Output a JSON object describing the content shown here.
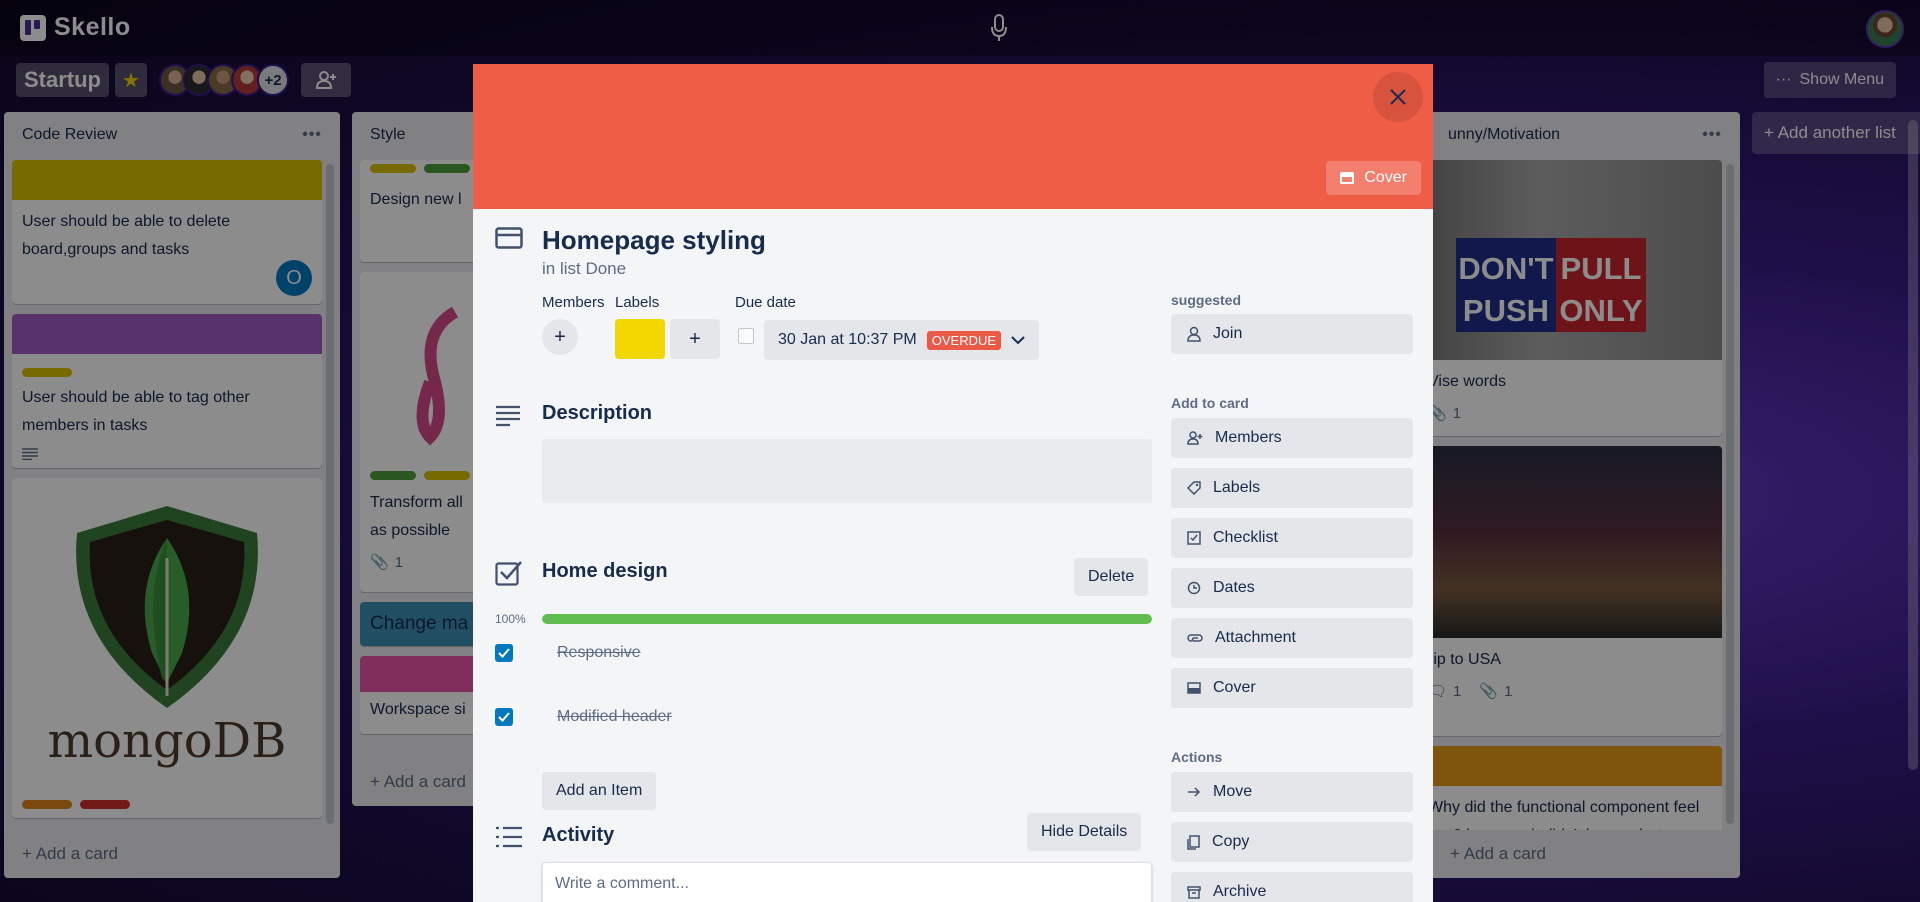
{
  "app": {
    "name": "Skello"
  },
  "board": {
    "title": "Startup",
    "extra_members": "+2",
    "show_menu_label": "Show Menu",
    "add_list_label": "Add another list"
  },
  "lists": {
    "code_review": {
      "title": "Code Review",
      "cards": [
        {
          "title": "User should be able to delete board,groups and tasks",
          "member_initial": "O"
        },
        {
          "title": "User should be able to tag other members in tasks"
        },
        {
          "logo_text": "mongoDB"
        }
      ],
      "add_card": "Add a card"
    },
    "style": {
      "title": "Style",
      "cards": [
        {
          "title": "Design new l"
        },
        {
          "title": "Transform all as possible",
          "attachments": "1"
        },
        {
          "title": "Change ma"
        },
        {
          "title": "Workspace si"
        }
      ],
      "add_card": "Add a card"
    },
    "funny": {
      "title": "unny/Motivation",
      "cards": [
        {
          "title": "Vise words",
          "attachments": "1",
          "sign_left": "DON'T PUSH",
          "sign_right": "PULL ONLY"
        },
        {
          "title": "rip to USA",
          "comments": "1",
          "attachments": "1"
        },
        {
          "title": "Why did the functional component feel lost? because it didn't know what"
        }
      ],
      "add_card": "Add a card"
    }
  },
  "modal": {
    "cover_button": "Cover",
    "title": "Homepage styling",
    "subtitle": "in list Done",
    "members_label": "Members",
    "labels_label": "Labels",
    "due_label": "Due date",
    "due_date": "30 Jan at 10:37 PM",
    "overdue_badge": "OVERDUE",
    "label_color": "#f2d600",
    "description_title": "Description",
    "checklist": {
      "title": "Home design",
      "delete_label": "Delete",
      "percent": "100%",
      "progress": 1.0,
      "items": [
        {
          "text": "Responsive",
          "done": true
        },
        {
          "text": "Modified header",
          "done": true
        }
      ],
      "add_item_label": "Add an Item"
    },
    "activity": {
      "title": "Activity",
      "hide_details_label": "Hide Details",
      "comment_placeholder": "Write a comment..."
    },
    "sidebar": {
      "suggested_heading": "suggested",
      "join_label": "Join",
      "add_heading": "Add to card",
      "add_items": [
        "Members",
        "Labels",
        "Checklist",
        "Dates",
        "Attachment",
        "Cover"
      ],
      "actions_heading": "Actions",
      "action_items": [
        "Move",
        "Copy",
        "Archive"
      ]
    }
  },
  "colors": {
    "cover": "#f05d46",
    "progress": "#61bd4f",
    "checkbox": "#0079bf",
    "overdue": "#eb5a46"
  }
}
